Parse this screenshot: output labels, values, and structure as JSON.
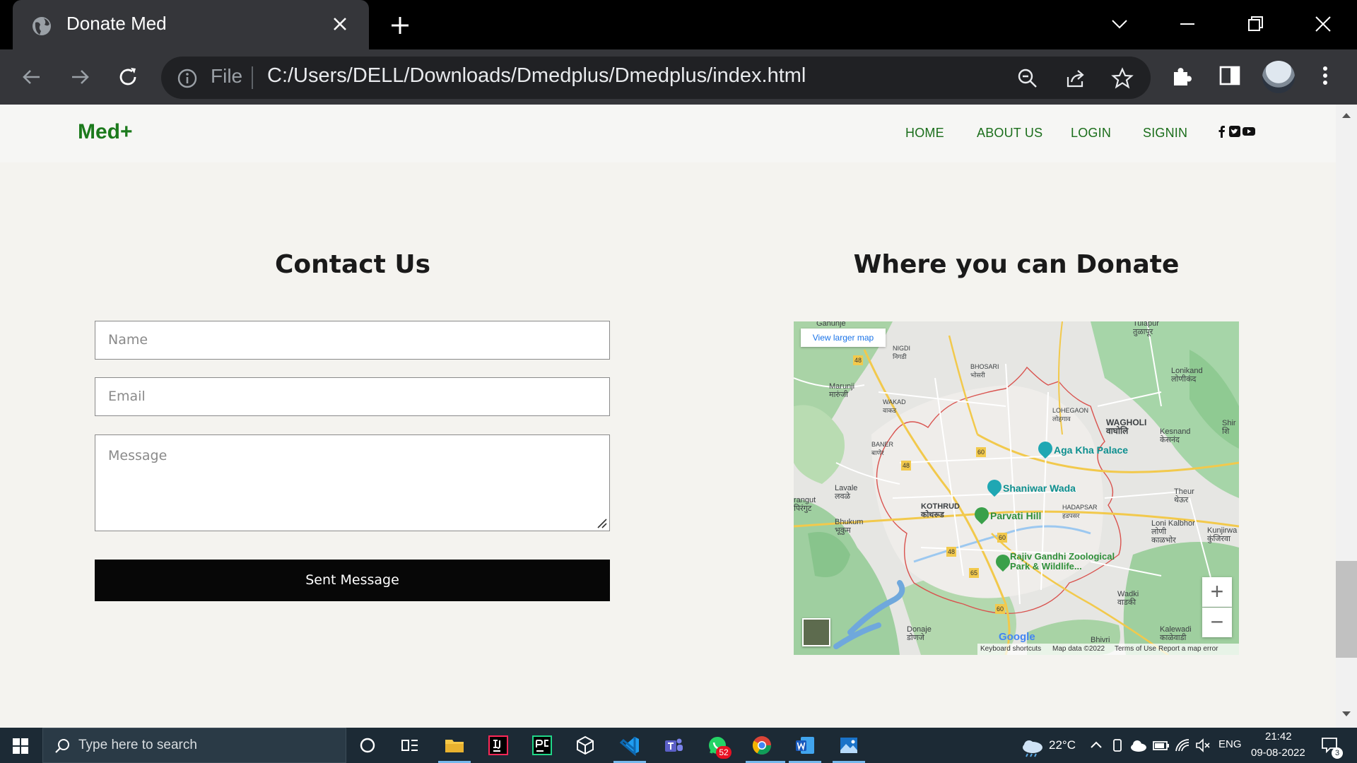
{
  "browser": {
    "tab_title": "Donate Med",
    "address_scheme": "File",
    "address_url": "C:/Users/DELL/Downloads/Dmedplus/Dmedplus/index.html"
  },
  "site": {
    "logo": "Med+",
    "nav": [
      {
        "label": "HOME"
      },
      {
        "label": "ABOUT US"
      },
      {
        "label": "LOGIN"
      },
      {
        "label": "SIGNIN"
      }
    ],
    "social_icons": [
      "facebook-icon",
      "twitter-icon",
      "youtube-icon"
    ],
    "brand_color": "#1c7a1c"
  },
  "contact": {
    "heading": "Contact Us",
    "name_placeholder": "Name",
    "email_placeholder": "Email",
    "message_placeholder": "Message",
    "submit_label": "Sent Message"
  },
  "map_section": {
    "heading": "Where you can Donate",
    "view_larger": "View larger map",
    "labels": {
      "ganunje": "Ganunje",
      "tulapur": "Tulapur\nतुळापूर",
      "nigdi": "NIGDI\nनिगडी",
      "bhosari": "BHOSARI\nभोसरी",
      "lonikand": "Lonikand\nलोणीकंद",
      "marunji": "Marunji\nमारुंजी",
      "wakad": "WAKAD\nवाकड",
      "lohegaon": "LOHEGAON\nलोहगाव",
      "wagholi": "WAGHOLI\nवाघोलि",
      "kesnand": "Kesnand\nकेसनंद",
      "shir": "Shir\nशि",
      "baner": "BANER\nबाणेर",
      "lavale": "Lavale\nलवळे",
      "rangut": "rangut\nपिरंगुट",
      "kothrud": "KOTHRUD\nकोथरूड",
      "hadapsar": "HADAPSAR\nहडपसर",
      "theur": "Theur\nथेऊर",
      "bhukum": "Bhukum\nभूकुम",
      "lonikalbhor": "Loni Kalbhor\nलोणी\nकाळभोर",
      "kunjirwa": "Kunjirwa\nकुंजिरवा",
      "wadki": "Wadki\nवाडकी",
      "donje": "Donaje\nडोणजे",
      "kalewadi": "Kalewadi\nकाळेवाडी",
      "bhivri": "Bhivri"
    },
    "poi": {
      "agakhan": "Aga Kha Palace",
      "shaniwar": "Shaniwar Wada",
      "parvati": "Parvati Hill",
      "rajiv": "Rajiv Gandhi Zoological\nPark & Wildlife..."
    },
    "shields": [
      "48",
      "48",
      "60",
      "48",
      "60",
      "48",
      "65",
      "60"
    ],
    "zoom_in": "+",
    "zoom_out": "−",
    "google": "Google",
    "footer": {
      "shortcuts": "Keyboard shortcuts",
      "mapdata": "Map data ©2022",
      "terms": "Terms of Use",
      "report": "Report a map error"
    }
  },
  "taskbar": {
    "search_placeholder": "Type here to search",
    "whatsapp_badge": "52",
    "weather": "22°C",
    "language": "ENG",
    "time": "21:42",
    "date": "09-08-2022",
    "notification_count": "3"
  }
}
